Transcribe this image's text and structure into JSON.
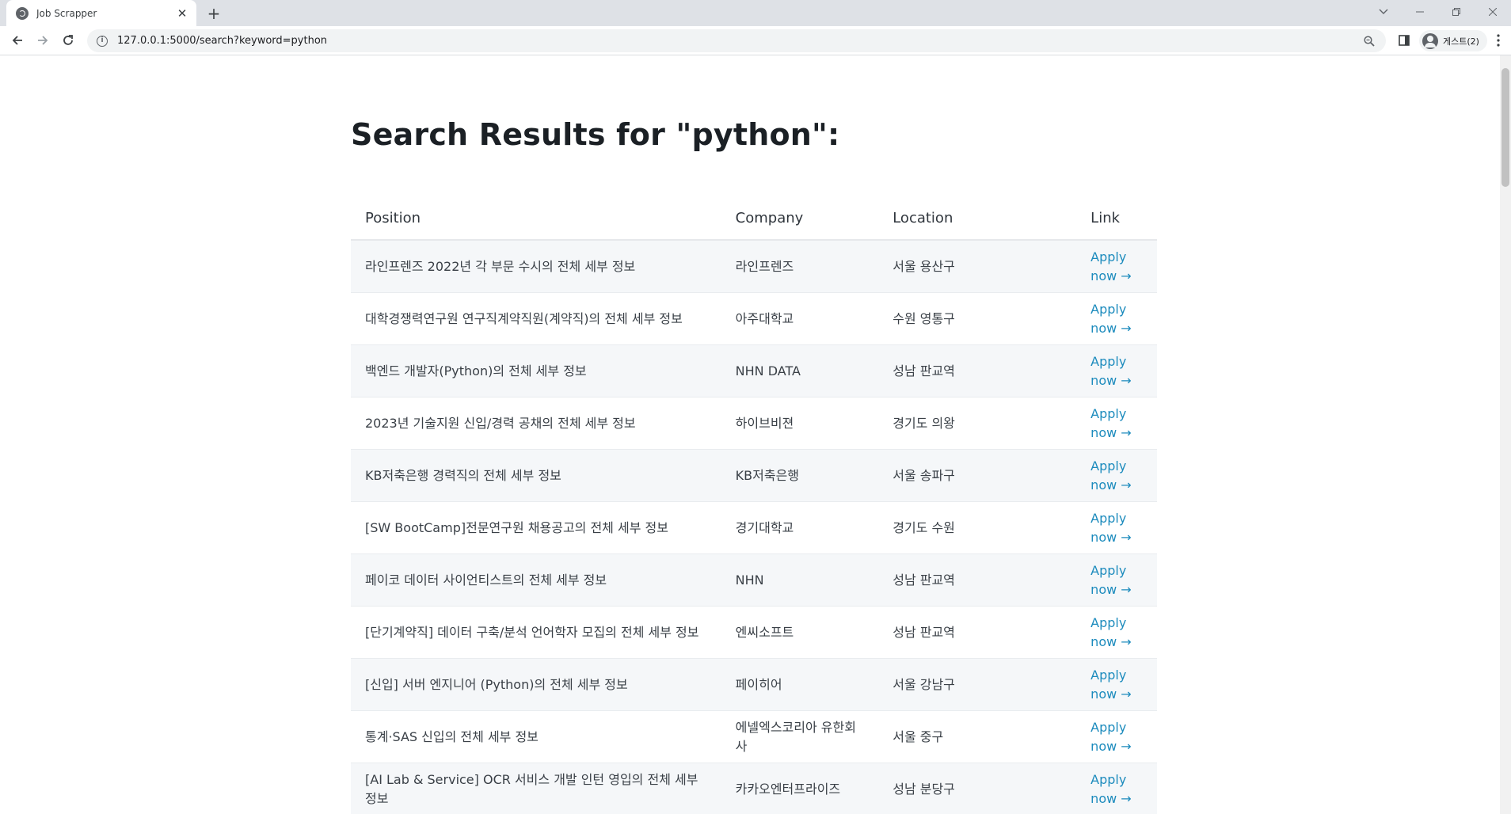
{
  "browser": {
    "tab_title": "Job Scrapper",
    "tab_close": "✕",
    "new_tab": "+",
    "url": "127.0.0.1:5000/search?keyword=python",
    "profile_name": "게스트(2)"
  },
  "page": {
    "title": "Search Results for \"python\":"
  },
  "table": {
    "headers": {
      "position": "Position",
      "company": "Company",
      "location": "Location",
      "link": "Link"
    },
    "apply_label": "Apply now →",
    "rows": [
      {
        "position": "라인프렌즈 2022년 각 부문 수시의 전체 세부 정보",
        "company": "라인프렌즈",
        "location": "서울 용산구"
      },
      {
        "position": "대학경쟁력연구원 연구직계약직원(계약직)의 전체 세부 정보",
        "company": "아주대학교",
        "location": "수원 영통구"
      },
      {
        "position": "백엔드 개발자(Python)의 전체 세부 정보",
        "company": "NHN DATA",
        "location": "성남 판교역"
      },
      {
        "position": "2023년 기술지원 신입/경력 공채의 전체 세부 정보",
        "company": "하이브비젼",
        "location": "경기도 의왕"
      },
      {
        "position": "KB저축은행 경력직의 전체 세부 정보",
        "company": "KB저축은행",
        "location": "서울 송파구"
      },
      {
        "position": "[SW BootCamp]전문연구원 채용공고의 전체 세부 정보",
        "company": "경기대학교",
        "location": "경기도 수원"
      },
      {
        "position": "페이코 데이터 사이언티스트의 전체 세부 정보",
        "company": "NHN",
        "location": "성남 판교역"
      },
      {
        "position": "[단기계약직] 데이터 구축/분석 언어학자 모집의 전체 세부 정보",
        "company": "엔씨소프트",
        "location": "성남 판교역"
      },
      {
        "position": "[신입] 서버 엔지니어 (Python)의 전체 세부 정보",
        "company": "페이히어",
        "location": "서울 강남구"
      },
      {
        "position": "통계·SAS 신입의 전체 세부 정보",
        "company": "에넬엑스코리아 유한회사",
        "location": "서울 중구"
      },
      {
        "position": "[AI Lab & Service] OCR 서비스 개발 인턴 영입의 전체 세부 정보",
        "company": "카카오엔터프라이즈",
        "location": "성남 분당구"
      }
    ]
  }
}
